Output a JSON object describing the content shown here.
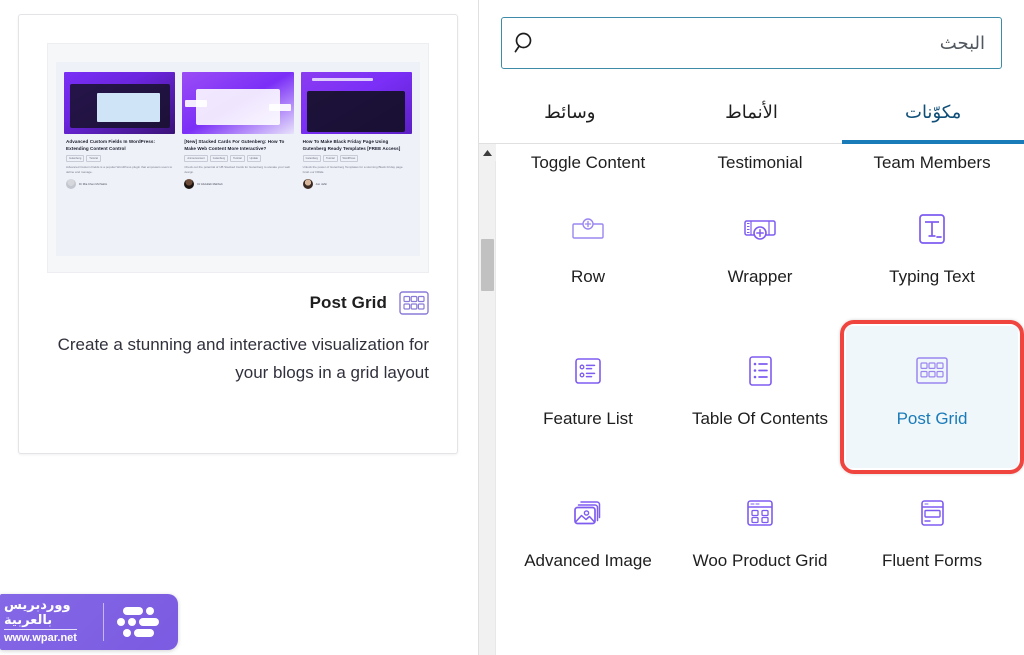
{
  "preview": {
    "title": "Post Grid",
    "description": "Create a stunning and interactive visualization for your blogs in a grid layout",
    "icon": "post-grid-icon",
    "thumbnail_posts": [
      {
        "title": "How To Make Black Friday Page Using Gutenberg Ready Templates [FREE Access]",
        "tags": [
          "Gutenberg",
          "Tutorial",
          "WordPress"
        ],
        "excerpt": "Unlock the power of Gutenberg Templates for a stunning Black Friday page. Grab our FREE.",
        "author": "Jon Jahir",
        "banner_caption": "Black Friday Templates For Gutenberg"
      },
      {
        "title": "[New] Stacked Cards For Gutenberg: How To Make Web Content More Interactive?",
        "tags": [
          "Announcement",
          "Gutenberg",
          "Tutorial",
          "Update"
        ],
        "excerpt": "Check out the potential of UB Stacked Cards for Gutenberg to elevate your web design.",
        "author": "Dr Abdullah Mahbub",
        "banner_caption": ""
      },
      {
        "title": "Advanced Custom Fields In WordPress: Extending Content Control",
        "tags": [
          "Gutenberg",
          "Tutorial"
        ],
        "excerpt": "Advanced Custom Fields is a popular WordPress plugin that empowers users to define and manage.",
        "author": "Dr Mia Chen Md Salim",
        "banner_caption": ""
      }
    ]
  },
  "watermark": {
    "line1": "ووردبريس",
    "line2": "بالعربية",
    "url": "www.wpar.net"
  },
  "search": {
    "placeholder": "البحث",
    "value": "",
    "icon": "search-icon"
  },
  "tabs": [
    {
      "label": "مكوّنات",
      "active": true
    },
    {
      "label": "الأنماط",
      "active": false
    },
    {
      "label": "وسائط",
      "active": false
    }
  ],
  "blocks": [
    {
      "label": "Team Members",
      "icon": "team-members-icon",
      "partial": true,
      "selected": false
    },
    {
      "label": "Testimonial",
      "icon": "testimonial-icon",
      "partial": true,
      "selected": false
    },
    {
      "label": "Toggle Content",
      "icon": "toggle-content-icon",
      "partial": true,
      "selected": false
    },
    {
      "label": "Typing Text",
      "icon": "typing-text-icon",
      "partial": false,
      "selected": false
    },
    {
      "label": "Wrapper",
      "icon": "wrapper-icon",
      "partial": false,
      "selected": false
    },
    {
      "label": "Row",
      "icon": "row-icon",
      "partial": false,
      "selected": false
    },
    {
      "label": "Post Grid",
      "icon": "post-grid-icon",
      "partial": false,
      "selected": true
    },
    {
      "label": "Table Of Contents",
      "icon": "table-of-contents-icon",
      "partial": false,
      "selected": false
    },
    {
      "label": "Feature List",
      "icon": "feature-list-icon",
      "partial": false,
      "selected": false
    },
    {
      "label": "Fluent Forms",
      "icon": "fluent-forms-icon",
      "partial": false,
      "selected": false
    },
    {
      "label": "Woo Product Grid",
      "icon": "woo-product-grid-icon",
      "partial": false,
      "selected": false
    },
    {
      "label": "Advanced Image",
      "icon": "advanced-image-icon",
      "partial": false,
      "selected": false
    }
  ],
  "colors": {
    "icon_purple": "#7e5cf0",
    "accent_blue": "#1a7bb9",
    "highlight_red": "#f0443e",
    "selected_bg": "#f0f7fb",
    "watermark_purple": "#7b5be1"
  },
  "scrollbar": {
    "up_arrow": "triangle-up-icon"
  }
}
